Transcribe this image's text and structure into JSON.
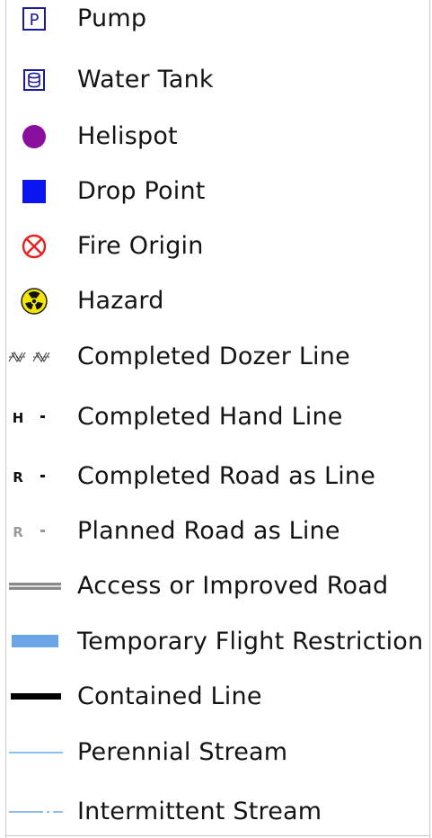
{
  "legend": {
    "items": [
      {
        "id": "pump",
        "label": "Pump",
        "icon": "pump-icon",
        "glyph": "P",
        "color": "#1a1a9c"
      },
      {
        "id": "water-tank",
        "label": "Water Tank",
        "icon": "water-tank-icon",
        "color": "#1a1a9c"
      },
      {
        "id": "helispot",
        "label": "Helispot",
        "icon": "helispot-icon",
        "color": "#8b0f9e"
      },
      {
        "id": "drop-point",
        "label": "Drop Point",
        "icon": "drop-point-icon",
        "color": "#0a14f0"
      },
      {
        "id": "fire-origin",
        "label": "Fire Origin",
        "icon": "fire-origin-icon",
        "color": "#e62020"
      },
      {
        "id": "hazard",
        "label": "Hazard",
        "icon": "hazard-icon",
        "color": "#f2e600"
      },
      {
        "id": "completed-dozer-line",
        "label": "Completed Dozer Line",
        "icon": "dozer-line-icon",
        "color": "#222222"
      },
      {
        "id": "completed-hand-line",
        "label": "Completed Hand Line",
        "icon": "hand-line-icon",
        "glyph": "H",
        "color": "#111111"
      },
      {
        "id": "completed-road-as-line",
        "label": "Completed Road as Line",
        "icon": "road-line-icon",
        "glyph": "R",
        "color": "#111111"
      },
      {
        "id": "planned-road-as-line",
        "label": "Planned Road as Line",
        "icon": "planned-road-line-icon",
        "glyph": "R",
        "color": "#9a9a9a"
      },
      {
        "id": "access-road",
        "label": "Access or Improved Road",
        "icon": "access-road-icon",
        "color": "#8a8a8a"
      },
      {
        "id": "tfr",
        "label": "Temporary Flight Restriction",
        "icon": "tfr-icon",
        "color": "#6aa6e6"
      },
      {
        "id": "contained-line",
        "label": "Contained Line",
        "icon": "contained-line-icon",
        "color": "#000000"
      },
      {
        "id": "perennial-stream",
        "label": "Perennial Stream",
        "icon": "perennial-stream-icon",
        "color": "#8cc0ee"
      },
      {
        "id": "intermittent-stream",
        "label": "Intermittent Stream",
        "icon": "intermittent-stream-icon",
        "color": "#8cc0ee"
      }
    ]
  }
}
